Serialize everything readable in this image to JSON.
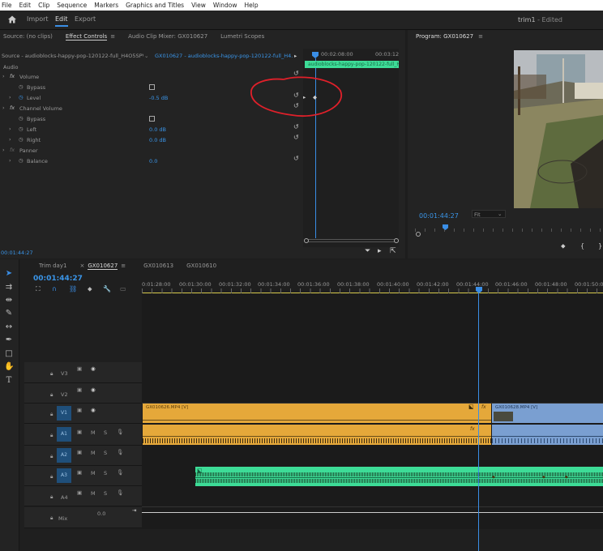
{
  "menu": [
    "File",
    "Edit",
    "Clip",
    "Sequence",
    "Markers",
    "Graphics and Titles",
    "View",
    "Window",
    "Help"
  ],
  "workspaces": {
    "import": "Import",
    "edit": "Edit",
    "export": "Export"
  },
  "document_title": "trim1",
  "document_status": "- Edited",
  "source_tabs": [
    "Source: (no clips)",
    "Effect Controls",
    "Audio Clip Mixer: GX010627",
    "Lumetri Scopes"
  ],
  "source_menu_icon": "≡",
  "effect_controls": {
    "source_label": "Source - audioblocks-happy-pop-120122-full_H4O5SPV...",
    "clip_label": "GX010627 - audioblocks-happy-pop-120122-full_H4...",
    "section_audio": "Audio",
    "volume": {
      "name": "Volume",
      "bypass": "Bypass",
      "level_label": "Level",
      "level_value": "-0.5 dB"
    },
    "channel_volume": {
      "name": "Channel Volume",
      "bypass": "Bypass",
      "left_label": "Left",
      "left_value": "0.0 dB",
      "right_label": "Right",
      "right_value": "0.0 dB"
    },
    "panner": {
      "name": "Panner",
      "balance_label": "Balance",
      "balance_value": "0.0"
    },
    "time_start": "00:02:08:00",
    "time_end": "00:03:12",
    "mini_clip_label": "audioblocks-happy-pop-120122-full_H4",
    "timecode": "00:01:44:27"
  },
  "program_monitor": {
    "title": "Program: GX010627",
    "timecode": "00:01:44:27",
    "fit": "Fit"
  },
  "timeline": {
    "tabs": [
      "Trim day1",
      "GX010627",
      "GX010613",
      "GX010610"
    ],
    "timecode": "00:01:44:27",
    "ruler": [
      "0:01:28:00",
      "00:01:30:00",
      "00:01:32:00",
      "00:01:34:00",
      "00:01:36:00",
      "00:01:38:00",
      "00:01:40:00",
      "00:01:42:00",
      "00:01:44:00",
      "00:01:46:00",
      "00:01:48:00",
      "00:01:50:00"
    ],
    "tracks": {
      "v3": "V3",
      "v2": "V2",
      "v1": "V1",
      "a1": "A1",
      "a2": "A2",
      "a3": "A3",
      "a4": "A4",
      "src_v1": "V1",
      "src_a1": "A1",
      "mix": "Mix",
      "mix_value": "0.0",
      "m": "M",
      "s": "S"
    },
    "clips": {
      "video1": "GX010626.MP4 [V]",
      "video1_fx": "fx",
      "video2": "GX010628.MP4 [V]"
    }
  },
  "colors": {
    "accent": "#3a8ee6",
    "video_clip": "#e5a83a",
    "next_clip": "#7a9fd1",
    "audio_green": "#3ddc97",
    "annotation": "#e0202a"
  }
}
